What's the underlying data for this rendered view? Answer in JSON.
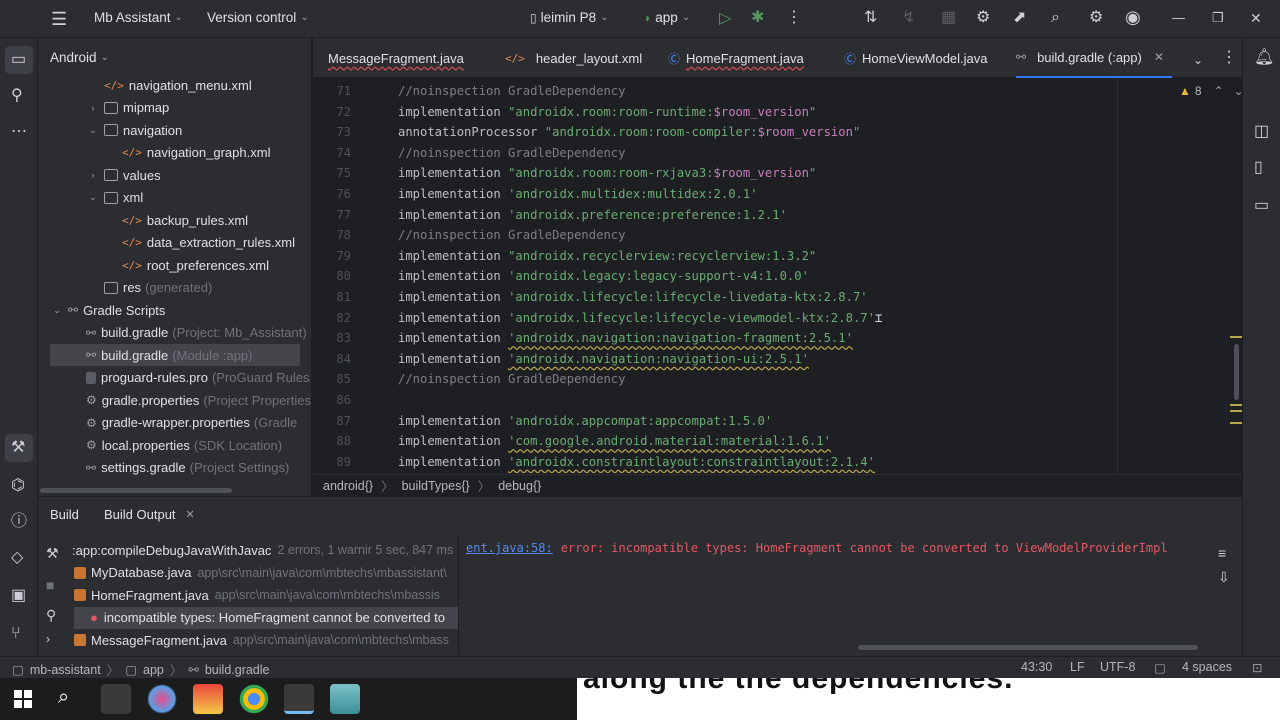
{
  "topbar": {
    "project_name": "Mb Assistant",
    "vcs": "Version control",
    "device": "leimin P8",
    "run_config": "app"
  },
  "project_panel": {
    "title": "Android",
    "tree": [
      {
        "label": "navigation_menu.xml",
        "hint": ""
      },
      {
        "label": "mipmap",
        "hint": ""
      },
      {
        "label": "navigation",
        "hint": ""
      },
      {
        "label": "navigation_graph.xml",
        "hint": ""
      },
      {
        "label": "values",
        "hint": ""
      },
      {
        "label": "xml",
        "hint": ""
      },
      {
        "label": "backup_rules.xml",
        "hint": ""
      },
      {
        "label": "data_extraction_rules.xml",
        "hint": ""
      },
      {
        "label": "root_preferences.xml",
        "hint": ""
      },
      {
        "label": "res",
        "hint": "(generated)"
      },
      {
        "label": "Gradle Scripts",
        "hint": ""
      },
      {
        "label": "build.gradle",
        "hint": "(Project: Mb_Assistant)"
      },
      {
        "label": "build.gradle",
        "hint": "(Module :app)"
      },
      {
        "label": "proguard-rules.pro",
        "hint": "(ProGuard Rules"
      },
      {
        "label": "gradle.properties",
        "hint": "(Project Properties"
      },
      {
        "label": "gradle-wrapper.properties",
        "hint": "(Gradle"
      },
      {
        "label": "local.properties",
        "hint": "(SDK Location)"
      },
      {
        "label": "settings.gradle",
        "hint": "(Project Settings)"
      }
    ]
  },
  "tabs": [
    {
      "label": "MessageFragment.java"
    },
    {
      "label": "header_layout.xml"
    },
    {
      "label": "HomeFragment.java"
    },
    {
      "label": "HomeViewModel.java"
    },
    {
      "label": "build.gradle (:app)"
    }
  ],
  "editor": {
    "warning_count": "8",
    "lines": [
      {
        "n": "71",
        "comment": "//noinspection GradleDependency"
      },
      {
        "n": "72",
        "kw": "implementation",
        "str": "\"androidx.room:room-runtime:",
        "var": "$room_version",
        "str2": "\""
      },
      {
        "n": "73",
        "kw": "annotationProcessor",
        "str": "\"androidx.room:room-compiler:",
        "var": "$room_version",
        "str2": "\""
      },
      {
        "n": "74",
        "comment": "//noinspection GradleDependency"
      },
      {
        "n": "75",
        "kw": "implementation",
        "str": "\"androidx.room:room-rxjava3:",
        "var": "$room_version",
        "str2": "\""
      },
      {
        "n": "76",
        "kw": "implementation",
        "str": "'androidx.multidex:multidex:2.0.1'"
      },
      {
        "n": "77",
        "kw": "implementation",
        "str": "'androidx.preference:preference:1.2.1'"
      },
      {
        "n": "78",
        "comment": "//noinspection GradleDependency"
      },
      {
        "n": "79",
        "kw": "implementation",
        "str": "\"androidx.recyclerview:recyclerview:1.3.2\""
      },
      {
        "n": "80",
        "kw": "implementation",
        "str": "'androidx.legacy:legacy-support-v4:1.0.0'"
      },
      {
        "n": "81",
        "kw": "implementation",
        "str": "'androidx.lifecycle:lifecycle-livedata-ktx:2.8.7'"
      },
      {
        "n": "82",
        "kw": "implementation",
        "str": "'androidx.lifecycle:lifecycle-viewmodel-ktx:2.8.7'"
      },
      {
        "n": "83",
        "kw": "implementation",
        "str": "'androidx.navigation:navigation-fragment:2.5.1'"
      },
      {
        "n": "84",
        "kw": "implementation",
        "str": "'androidx.navigation:navigation-ui:2.5.1'"
      },
      {
        "n": "85",
        "comment": "//noinspection GradleDependency"
      },
      {
        "n": "86"
      },
      {
        "n": "87",
        "kw": "implementation",
        "str": "'androidx.appcompat:appcompat:1.5.0'"
      },
      {
        "n": "88",
        "kw": "implementation",
        "str": "'com.google.android.material:material:1.6.1'"
      },
      {
        "n": "89",
        "kw": "implementation",
        "str": "'androidx.constraintlayout:constraintlayout:2.1.4'"
      }
    ],
    "breadcrumb": [
      "android{}",
      "buildTypes{}",
      "debug{}"
    ]
  },
  "build_panel": {
    "tab_build": "Build",
    "tab_output": "Build Output",
    "rows": [
      {
        "label": ":app:compileDebugJavaWithJavac",
        "hint": "2 errors, 1 warnir 5 sec, 847 ms"
      },
      {
        "label": "MyDatabase.java",
        "hint": "app\\src\\main\\java\\com\\mbtechs\\mbassistant\\"
      },
      {
        "label": "HomeFragment.java",
        "hint": "app\\src\\main\\java\\com\\mbtechs\\mbassis"
      },
      {
        "label": "incompatible types: HomeFragment cannot be converted to",
        "hint": ""
      },
      {
        "label": "MessageFragment.java",
        "hint": "app\\src\\main\\java\\com\\mbtechs\\mbass"
      }
    ],
    "output_link": "ent.java:58:",
    "output_text": "error: incompatible types: HomeFragment cannot be converted to ViewModelProviderImpl"
  },
  "statusbar": {
    "path": [
      "mb-assistant",
      "app",
      "build.gradle"
    ],
    "position": "43:30",
    "line_sep": "LF",
    "encoding": "UTF-8",
    "indent": "4 spaces"
  },
  "caption": {
    "text": "along the the dependencies."
  }
}
